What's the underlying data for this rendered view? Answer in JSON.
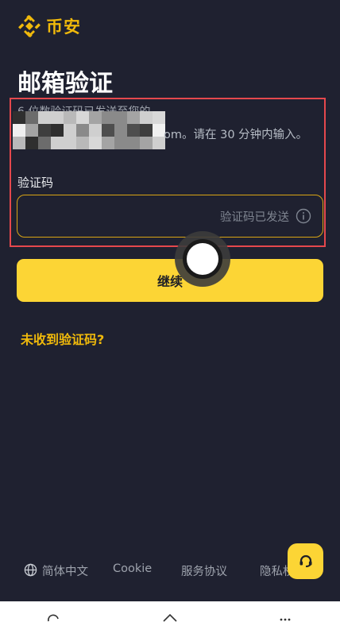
{
  "brand": {
    "name": "币安",
    "color": "#f0b90b"
  },
  "page": {
    "title": "邮箱验证"
  },
  "message": {
    "line1": "6 位数验证码已发送至您的",
    "line2_suffix": "om。请在 30 分钟内输入。"
  },
  "form": {
    "code_label": "验证码",
    "code_value": "",
    "sent_status": "验证码已发送"
  },
  "actions": {
    "continue_label": "继续",
    "resend_link": "未收到验证码?"
  },
  "footer": {
    "language": "简体中文",
    "cookie": "Cookie",
    "terms": "服务协议",
    "privacy": "隐私权"
  },
  "icons": {
    "logo": "binance-diamond-icon",
    "info": "info-icon",
    "language": "globe-icon",
    "support": "headset-icon",
    "bottom_bar": [
      "reload-icon",
      "share-icon",
      "menu-dots-icon"
    ]
  },
  "colors": {
    "background": "#1f2130",
    "accent": "#fcd535",
    "highlight": "#e5484d"
  }
}
